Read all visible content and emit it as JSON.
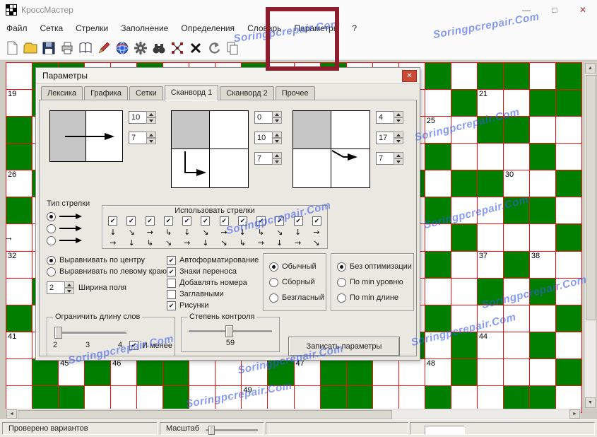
{
  "window": {
    "title": "КроссМастер",
    "controls": {
      "minimize": "—",
      "maximize": "□",
      "close": "✕"
    }
  },
  "menu": {
    "items": [
      "Файл",
      "Сетка",
      "Стрелки",
      "Заполнение",
      "Определения",
      "Словарь",
      "Параметры",
      "?"
    ],
    "highlighted": "Параметры"
  },
  "toolbar": {
    "icons": [
      "new-document",
      "open-folder",
      "save",
      "print",
      "dictionary",
      "edit-pencil",
      "globe",
      "settings-gear",
      "search-binoculars",
      "block-pattern",
      "delete-x",
      "undo",
      "copy"
    ]
  },
  "annotation": {
    "color": "#8e1d2d"
  },
  "watermark": {
    "text": "Soringpcrepair.Com",
    "color": "rgba(56,88,235,0.6)"
  },
  "grid": {
    "colors": {
      "block": "#007e00",
      "line": "#ee1111",
      "cell": "#ffffff"
    },
    "rows": [
      ".GG..G...G..G...G.GG.G",
      ".G..G...G..G..G..G..GG",
      "G..G...G..G..G....GG..",
      "G.G...G..G..G...G...G.",
      ".G...G..G...G..G.GG..G",
      "G..G...G..G..G..G..GG.",
      "..G.G..G...G..G..G...G",
      "...G..G.G...G...G..G..",
      ".G..G...G.G...G...G.G.",
      "G..G..G...G..G..G....G",
      "..G...G.G..G...G.G..G.",
      ".G.G.GG...G.GG...G...G",
      ".GG...G.....GG..G..GG."
    ],
    "numbers": [
      {
        "r": 1,
        "c": 0,
        "n": "19"
      },
      {
        "r": 1,
        "c": 18,
        "n": "21"
      },
      {
        "r": 2,
        "c": 16,
        "n": "25"
      },
      {
        "r": 4,
        "c": 0,
        "n": "26"
      },
      {
        "r": 4,
        "c": 19,
        "n": "30"
      },
      {
        "r": 7,
        "c": 0,
        "n": "32"
      },
      {
        "r": 7,
        "c": 18,
        "n": "37"
      },
      {
        "r": 7,
        "c": 20,
        "n": "38"
      },
      {
        "r": 10,
        "c": 0,
        "n": "41"
      },
      {
        "r": 10,
        "c": 18,
        "n": "44"
      },
      {
        "r": 11,
        "c": 2,
        "n": "45"
      },
      {
        "r": 11,
        "c": 4,
        "n": "46"
      },
      {
        "r": 11,
        "c": 11,
        "n": "47"
      },
      {
        "r": 11,
        "c": 16,
        "n": "48"
      },
      {
        "r": 12,
        "c": 9,
        "n": "49"
      }
    ],
    "arrows": [
      {
        "r": 6,
        "c": 0,
        "g": "→"
      }
    ]
  },
  "scroll": {
    "up": "▲",
    "down": "▼",
    "left": "◄",
    "right": "►"
  },
  "dialog": {
    "title": "Параметры",
    "close_glyph": "✕",
    "tabs": [
      "Лексика",
      "Графика",
      "Сетки",
      "Сканворд 1",
      "Сканворд 2",
      "Прочее"
    ],
    "active_tab": "Сканворд 1",
    "previews": [
      {
        "spinners": [
          "10",
          "7"
        ]
      },
      {
        "spinners": [
          "0",
          "10",
          "7"
        ]
      },
      {
        "spinners": [
          "4",
          "17",
          "7"
        ]
      }
    ],
    "arrow_type": {
      "title": "Тип стрелки",
      "options": [
        "arrow-straight",
        "arrow-straight",
        "arrow-straight"
      ],
      "selected": 0
    },
    "use_arrows": {
      "title": "Использовать стрелки",
      "checks": [
        true,
        true,
        true,
        true,
        true,
        true,
        true,
        true,
        true,
        true,
        true,
        true
      ],
      "arrows_row1": [
        "↓",
        "↘",
        "→",
        "↳",
        "↓",
        "↘",
        "→",
        "↓",
        "↳",
        "↘",
        "↓",
        "→"
      ],
      "arrows_row2": [
        "→",
        "↓",
        "↳",
        "↘",
        "→",
        "↓",
        "↘",
        "↳",
        "→",
        "↓",
        "→",
        "↘"
      ]
    },
    "alignment": {
      "options": [
        "Выравнивать по центру",
        "Выравнивать по левому краю"
      ],
      "selected": 0,
      "width_value": "2",
      "width_label": "Ширина поля"
    },
    "format_checks": [
      {
        "label": "Автоформатирование",
        "checked": true
      },
      {
        "label": "Знаки переноса",
        "checked": true
      },
      {
        "label": "Добавлять номера",
        "checked": false
      },
      {
        "label": "Заглавными",
        "checked": false
      },
      {
        "label": "Рисунки",
        "checked": true
      }
    ],
    "mode": {
      "options": [
        "Обычный",
        "Сборный",
        "Безгласный"
      ],
      "selected": 0
    },
    "optimization": {
      "options": [
        "Без оптимизации",
        "По min уровню",
        "По min длине"
      ],
      "selected": 0
    },
    "word_length": {
      "title": "Ограничить длину слов",
      "ticks": [
        "2",
        "3",
        "4"
      ],
      "checkbox": "И менее",
      "checked": true
    },
    "control": {
      "title": "Степень контроля",
      "value": "59"
    },
    "save_button": "Записать параметры"
  },
  "statusbar": {
    "checked_label": "Проверено вариантов",
    "zoom_label": "Масштаб"
  }
}
